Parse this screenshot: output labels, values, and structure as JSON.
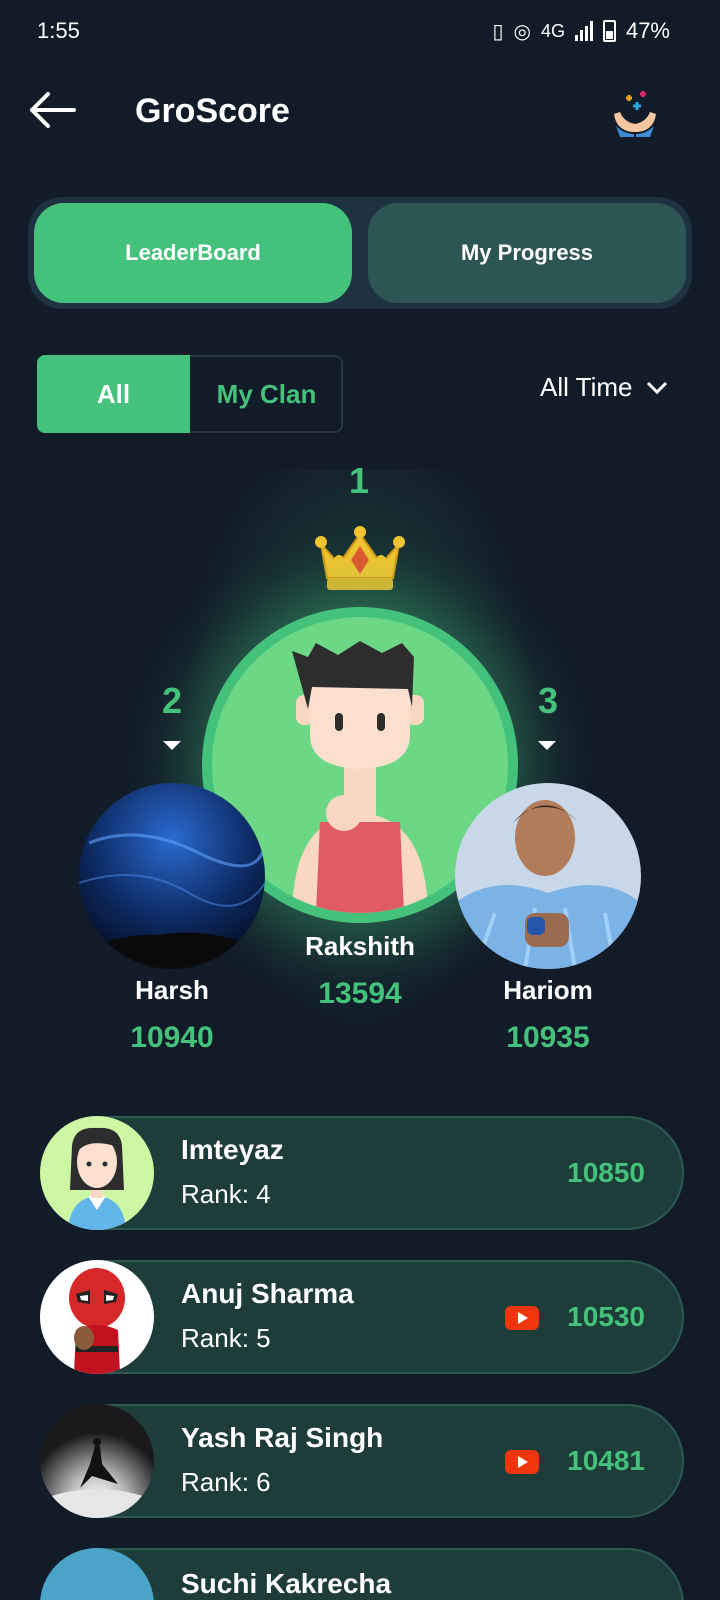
{
  "status": {
    "time": "1:55",
    "network": "4G",
    "battery": "47%"
  },
  "header": {
    "title": "GroScore"
  },
  "tabs": {
    "leaderboard": "LeaderBoard",
    "progress": "My Progress"
  },
  "filter": {
    "all": "All",
    "clan": "My Clan",
    "time_range": "All Time"
  },
  "podium": {
    "first": {
      "rank": "1",
      "name": "Rakshith",
      "score": "13594"
    },
    "second": {
      "rank": "2",
      "name": "Harsh",
      "score": "10940"
    },
    "third": {
      "rank": "3",
      "name": "Hariom",
      "score": "10935"
    }
  },
  "list": [
    {
      "name": "Imteyaz",
      "rank": "Rank: 4",
      "score": "10850"
    },
    {
      "name": "Anuj Sharma",
      "rank": "Rank: 5",
      "score": "10530"
    },
    {
      "name": "Yash Raj Singh",
      "rank": "Rank: 6",
      "score": "10481"
    },
    {
      "name": "Suchi Kakrecha"
    }
  ],
  "colors": {
    "accent": "#44c17b",
    "background": "#121c29",
    "row": "#1d3c3a",
    "youtube": "#f1350c"
  }
}
